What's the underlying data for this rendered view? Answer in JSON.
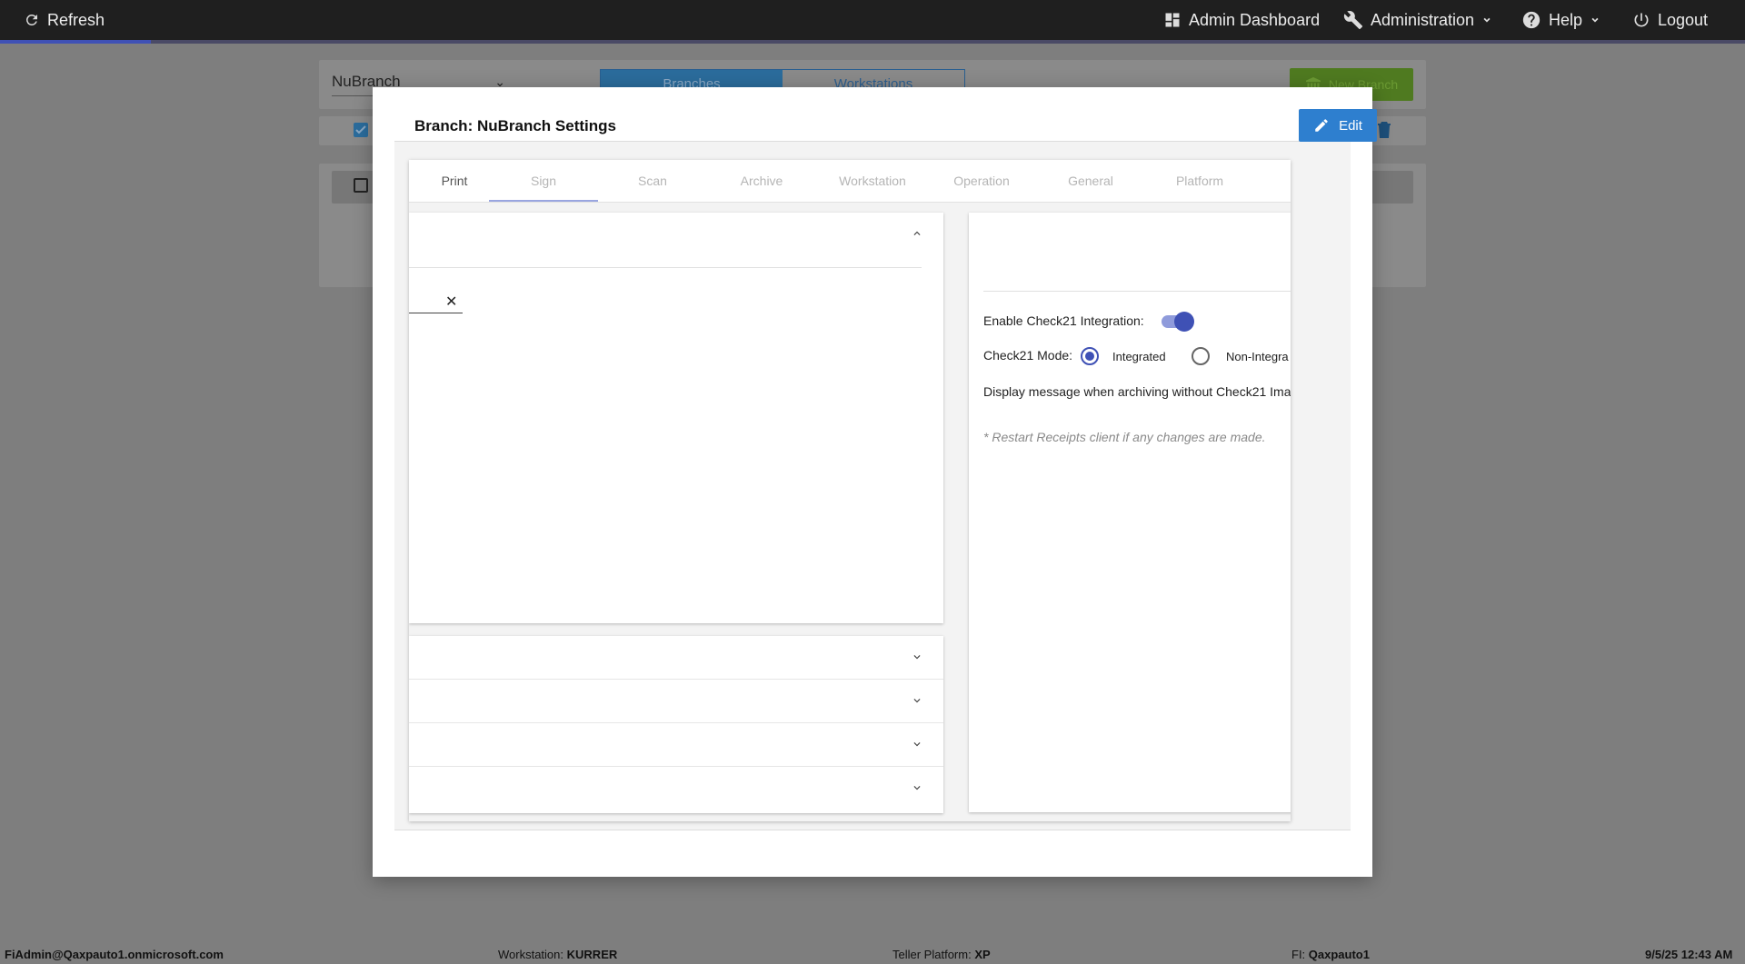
{
  "topbar": {
    "refresh_label": "Refresh",
    "admin_dashboard_label": "Admin Dashboard",
    "administration_label": "Administration",
    "help_label": "Help",
    "logout_label": "Logout"
  },
  "background": {
    "branch_select_value": "NuBranch",
    "tab_branches": "Branches",
    "tab_workstations": "Workstations",
    "new_branch_label": "New Branch"
  },
  "modal": {
    "title": "Branch: NuBranch Settings",
    "edit_label": "Edit",
    "tabs": [
      {
        "label": "Print"
      },
      {
        "label": "Sign"
      },
      {
        "label": "Scan"
      },
      {
        "label": "Archive"
      },
      {
        "label": "Workstation"
      },
      {
        "label": "Operation"
      },
      {
        "label": "General"
      },
      {
        "label": "Platform"
      }
    ],
    "active_tab": "Sign",
    "close_glyph": "✕",
    "check21": {
      "enable_label": "Enable Check21 Integration:",
      "enabled": true,
      "mode_label": "Check21 Mode:",
      "mode_options": [
        "Integrated",
        "Non-Integra"
      ],
      "mode_selected": "Integrated",
      "display_message_label": "Display message when archiving without Check21 Ima",
      "restart_note": "* Restart Receipts client if any changes are made."
    }
  },
  "footer": {
    "user": "FiAdmin@Qaxpauto1.onmicrosoft.com",
    "workstation_label": "Workstation:",
    "workstation_value": "KURRER",
    "platform_label": "Teller Platform:",
    "platform_value": "XP",
    "fi_label": "FI:",
    "fi_value": "Qaxpauto1",
    "datetime": "9/5/25 12:43 AM"
  },
  "colors": {
    "accent": "#3f51b5",
    "edit_button": "#2e7fcf",
    "topbar": "#1f1f1f",
    "overlay": "#7e7e7e"
  }
}
